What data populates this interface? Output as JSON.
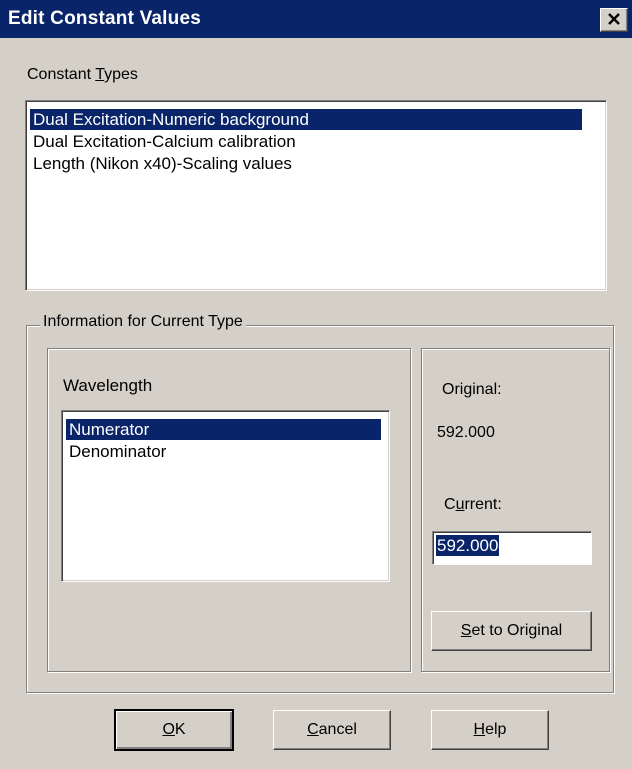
{
  "window": {
    "title": "Edit Constant Values"
  },
  "constant_types": {
    "label": "Constant Types",
    "items": [
      {
        "label": "Dual Excitation-Numeric background",
        "selected": true
      },
      {
        "label": "Dual Excitation-Calcium calibration",
        "selected": false
      },
      {
        "label": "Length (Nikon x40)-Scaling values",
        "selected": false
      }
    ]
  },
  "info_group": {
    "title": "Information for Current Type",
    "wavelength": {
      "label": "Wavelength",
      "items": [
        {
          "label": "Numerator",
          "selected": true
        },
        {
          "label": "Denominator",
          "selected": false
        }
      ]
    },
    "original_label": "Original:",
    "original_value": "592.000",
    "current_label": "Current:",
    "current_value": "592.000",
    "set_to_original_button": "Set to Original"
  },
  "buttons": {
    "ok": "OK",
    "cancel": "Cancel",
    "help": "Help"
  },
  "colors": {
    "title_bar": "#0a246a",
    "selection": "#0a246a",
    "face": "#d4d0c8"
  },
  "icons": {
    "close": "close-icon"
  }
}
